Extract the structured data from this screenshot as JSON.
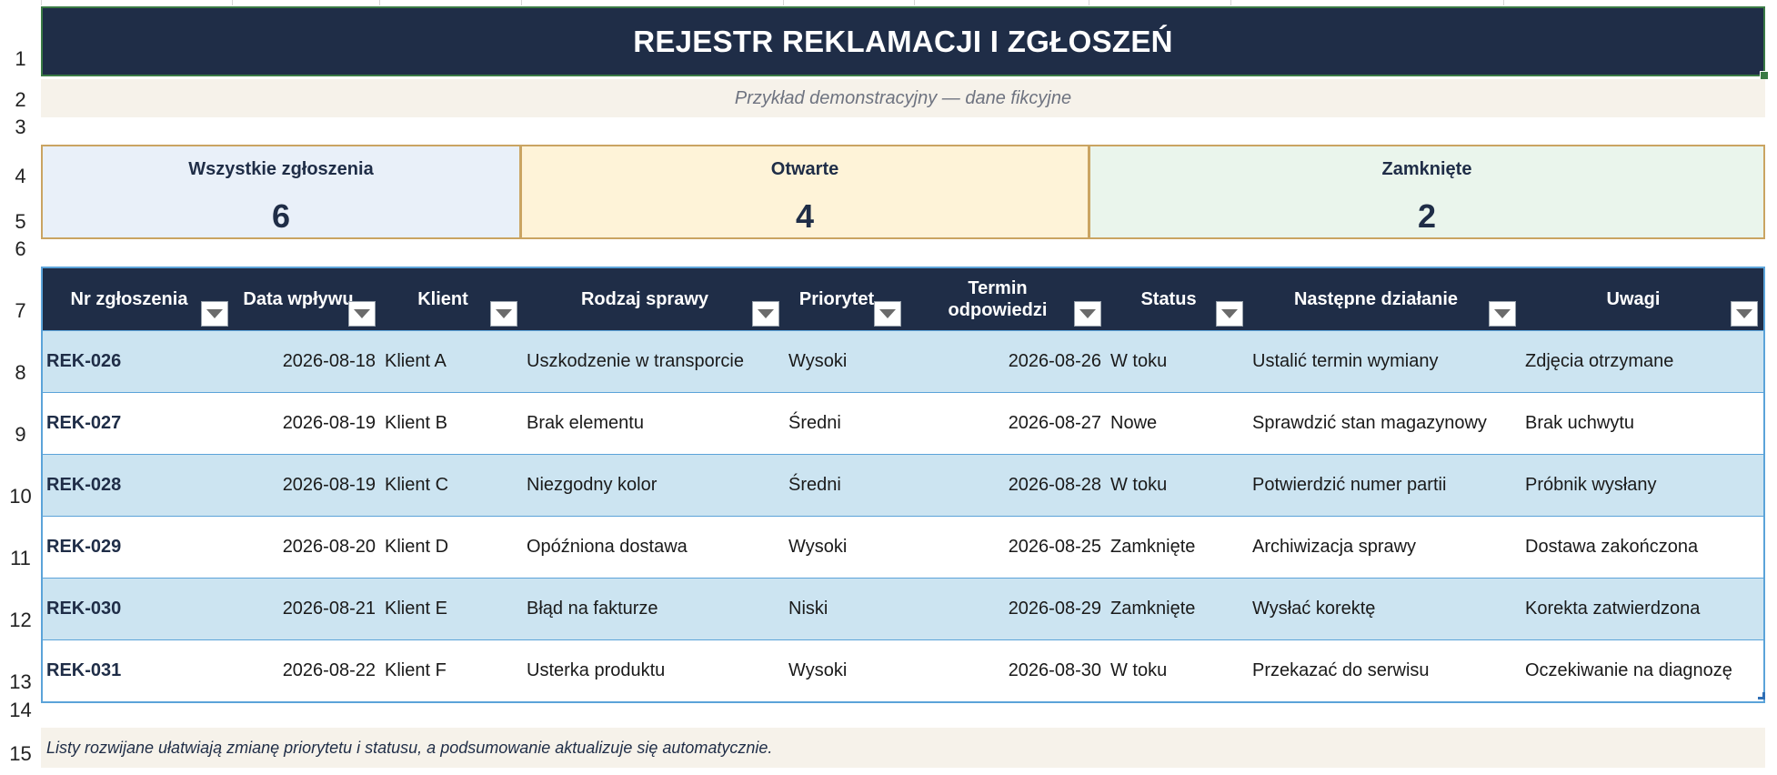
{
  "sheet": {
    "title": "REJESTR REKLAMACJI I ZGŁOSZEŃ",
    "subtitle": "Przykład demonstracyjny — dane fikcyjne",
    "footer_note": "Listy rozwijane ułatwiają zmianę priorytetu i statusu, a podsumowanie aktualizuje się automatycznie.",
    "row_numbers": [
      "1",
      "2",
      "3",
      "4",
      "5",
      "6",
      "7",
      "8",
      "9",
      "10",
      "11",
      "12",
      "13",
      "14",
      "15"
    ]
  },
  "summary": {
    "all": {
      "label": "Wszystkie zgłoszenia",
      "value": "6"
    },
    "open": {
      "label": "Otwarte",
      "value": "4"
    },
    "closed": {
      "label": "Zamknięte",
      "value": "2"
    }
  },
  "table": {
    "headers": [
      "Nr zgłoszenia",
      "Data wpływu",
      "Klient",
      "Rodzaj sprawy",
      "Priorytet",
      "Termin odpowiedzi",
      "Status",
      "Następne działanie",
      "Uwagi"
    ],
    "rows": [
      [
        "REK-026",
        "2026-08-18",
        "Klient A",
        "Uszkodzenie w transporcie",
        "Wysoki",
        "2026-08-26",
        "W toku",
        "Ustalić termin wymiany",
        "Zdjęcia otrzymane"
      ],
      [
        "REK-027",
        "2026-08-19",
        "Klient B",
        "Brak elementu",
        "Średni",
        "2026-08-27",
        "Nowe",
        "Sprawdzić stan magazynowy",
        "Brak uchwytu"
      ],
      [
        "REK-028",
        "2026-08-19",
        "Klient C",
        "Niezgodny kolor",
        "Średni",
        "2026-08-28",
        "W toku",
        "Potwierdzić numer partii",
        "Próbnik wysłany"
      ],
      [
        "REK-029",
        "2026-08-20",
        "Klient D",
        "Opóźniona dostawa",
        "Wysoki",
        "2026-08-25",
        "Zamknięte",
        "Archiwizacja sprawy",
        "Dostawa zakończona"
      ],
      [
        "REK-030",
        "2026-08-21",
        "Klient E",
        "Błąd na fakturze",
        "Niski",
        "2026-08-29",
        "Zamknięte",
        "Wysłać korektę",
        "Korekta zatwierdzona"
      ],
      [
        "REK-031",
        "2026-08-22",
        "Klient F",
        "Usterka produktu",
        "Wysoki",
        "2026-08-30",
        "W toku",
        "Przekazać do serwisu",
        "Oczekiwanie na diagnozę"
      ]
    ]
  },
  "colors": {
    "header_bg": "#1f2d47",
    "row_alt_bg": "#cce4f1",
    "kpi_border": "#caa462",
    "table_border": "#5ba3d9",
    "note_bg": "#f6f2ea"
  },
  "icons": {
    "filter": "filter-dropdown-icon"
  }
}
